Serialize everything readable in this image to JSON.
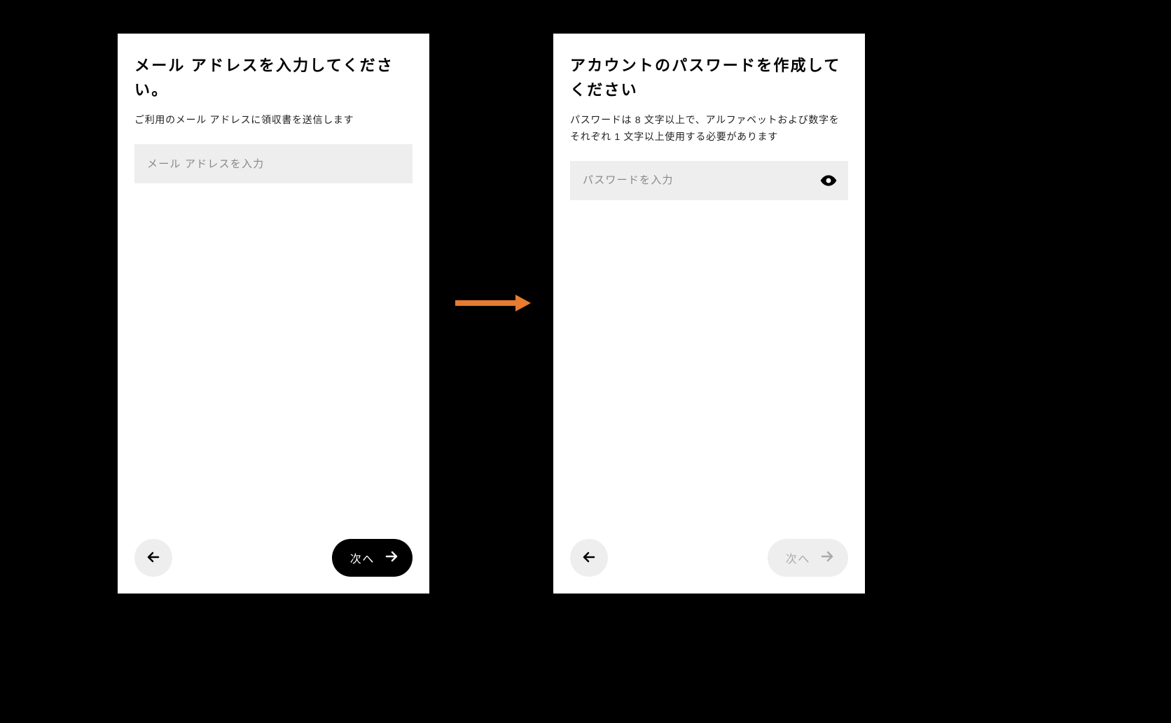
{
  "flow": {
    "arrow_color": "#E87B2F"
  },
  "screen1": {
    "title": "メール アドレスを入力してください。",
    "subtitle": "ご利用のメール アドレスに領収書を送信します",
    "input_placeholder": "メール アドレスを入力",
    "back_label": "戻る",
    "next_label": "次へ",
    "next_enabled": true
  },
  "screen2": {
    "title": "アカウントのパスワードを作成してください",
    "subtitle": "パスワードは 8 文字以上で、アルファベットおよび数字をそれぞれ 1 文字以上使用する必要があります",
    "input_placeholder": "パスワードを入力",
    "back_label": "戻る",
    "next_label": "次へ",
    "next_enabled": false
  }
}
